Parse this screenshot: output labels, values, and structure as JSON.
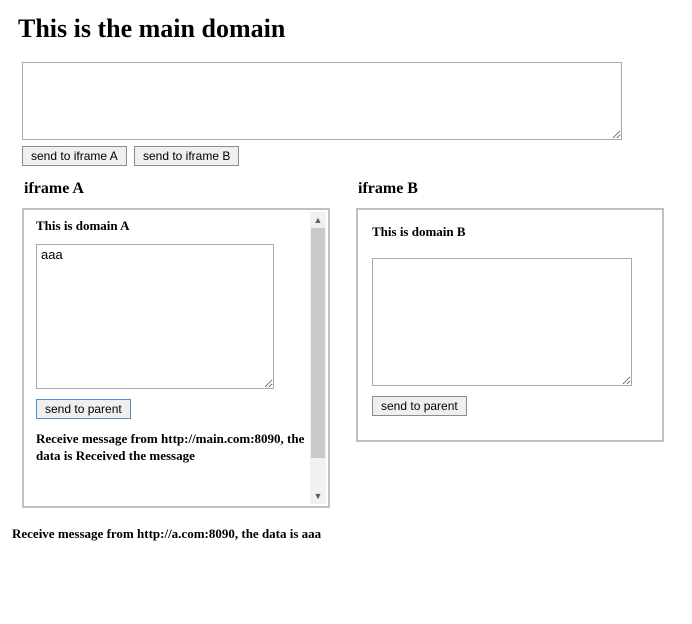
{
  "main": {
    "heading": "This is the main domain",
    "textarea_value": "",
    "buttons": {
      "send_a": "send to iframe A",
      "send_b": "send to iframe B"
    }
  },
  "iframe_a": {
    "title": "iframe A",
    "heading": "This is domain A",
    "textarea_value": "aaa",
    "send_label": "send to parent",
    "message": "Receive message from http://main.com:8090, the data is Received the message"
  },
  "iframe_b": {
    "title": "iframe B",
    "heading": "This is domain B",
    "textarea_value": "",
    "send_label": "send to parent"
  },
  "footer_message": "Receive message from http://a.com:8090, the data is aaa"
}
